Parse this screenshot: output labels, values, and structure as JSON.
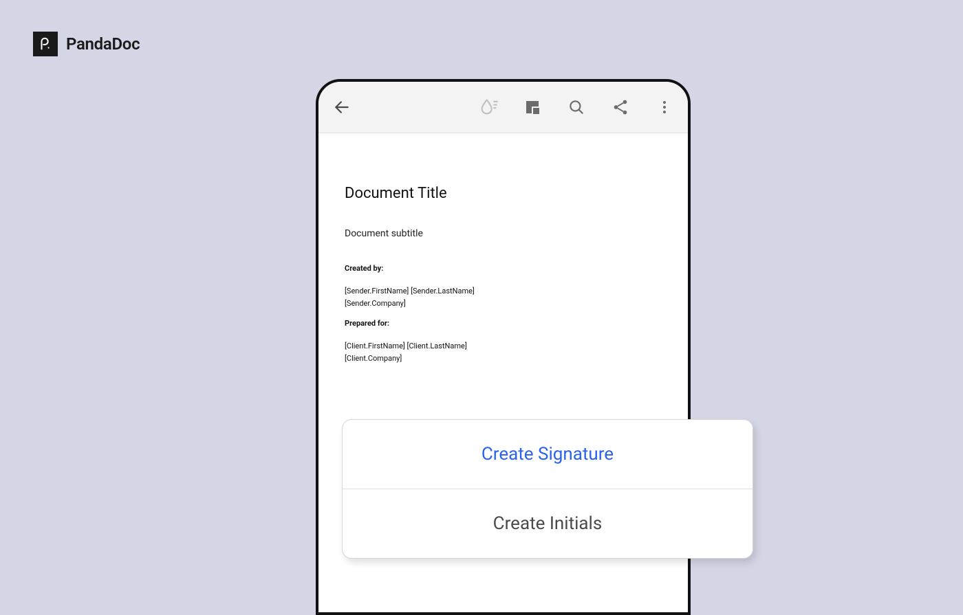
{
  "brand": {
    "name": "PandaDoc"
  },
  "toolbar": {
    "icons": {
      "back": "back-arrow",
      "ink": "ink-drop",
      "layout": "page-layout",
      "search": "search",
      "share": "share",
      "more": "more-vertical"
    }
  },
  "document": {
    "title": "Document Title",
    "subtitle": "Document subtitle",
    "created_by_label": "Created by:",
    "created_by_name": "[Sender.FirstName] [Sender.LastName]",
    "created_by_company": "[Sender.Company]",
    "prepared_for_label": "Prepared for:",
    "prepared_for_name": "[Client.FirstName] [Client.LastName]",
    "prepared_for_company": "[Client.Company]"
  },
  "sheet": {
    "primary": "Create Signature",
    "secondary": "Create Initials"
  }
}
